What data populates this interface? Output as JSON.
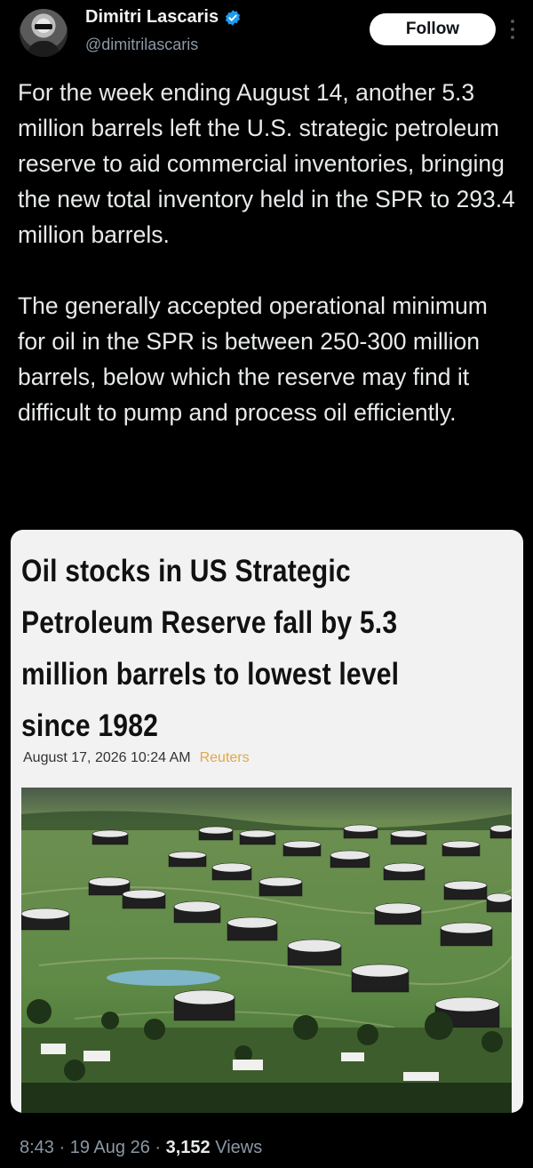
{
  "author": {
    "display_name": "Dimitri Lascaris",
    "handle": "@dimitrilascaris",
    "verified_icon": "verified-badge-icon"
  },
  "follow_label": "Follow",
  "post": {
    "paragraphs": [
      "For the week ending August 14, another 5.3 million barrels left the U.S. strategic petroleum reserve to aid commercial inventories, bringing the new total inventory held in the SPR to 293.4 million barrels.",
      "The generally accepted operational minimum for oil in the SPR is between 250-300 million barrels, below which the reserve may find it difficult to pump and process oil efficiently."
    ]
  },
  "card": {
    "headline": "Oil stocks in US Strategic Petroleum Reserve fall by 5.3 million barrels to lowest level since 1982",
    "date": "August 17, 2026 10:24 AM",
    "source": "Reuters"
  },
  "footer": {
    "time": "8:43",
    "date": "19 Aug 26",
    "views_count": "3,152",
    "views_label": "Views"
  },
  "colors": {
    "background": "#000000",
    "accent_verified": "#1d9bf0",
    "source_color": "#e0a84a"
  }
}
